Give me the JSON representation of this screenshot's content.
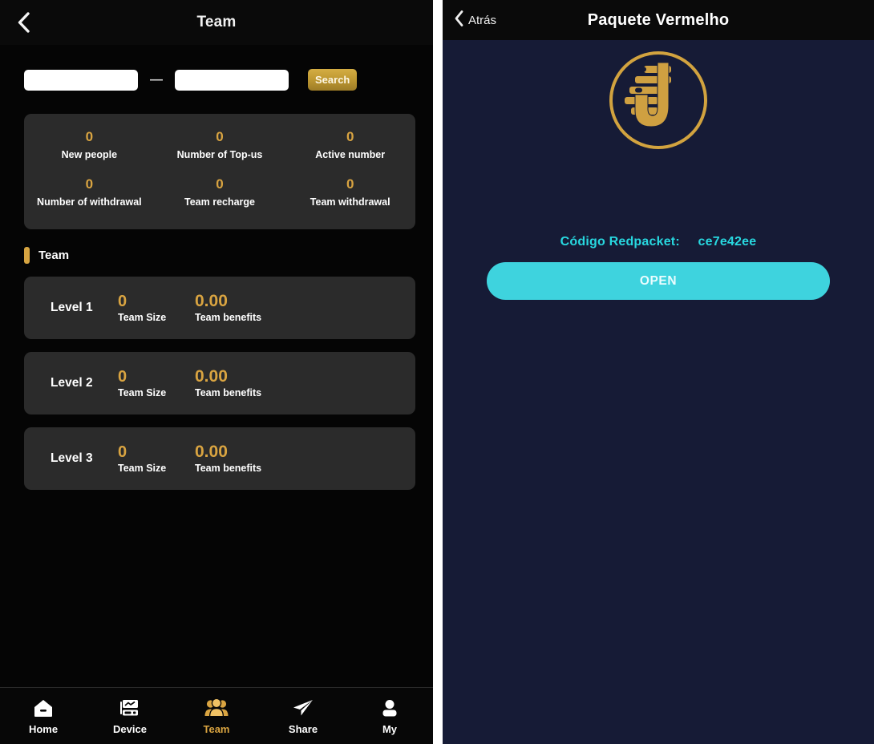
{
  "left": {
    "header": {
      "title": "Team",
      "back_icon": "chevron-left-icon"
    },
    "search": {
      "from_value": "",
      "to_value": "",
      "from_placeholder": "",
      "to_placeholder": "",
      "separator": "—",
      "button_label": "Search"
    },
    "stats": [
      {
        "value": "0",
        "label": "New people"
      },
      {
        "value": "0",
        "label": "Number of Top-us"
      },
      {
        "value": "0",
        "label": "Active number"
      },
      {
        "value": "0",
        "label": "Number of withdrawal"
      },
      {
        "value": "0",
        "label": "Team recharge"
      },
      {
        "value": "0",
        "label": "Team withdrawal"
      }
    ],
    "section": {
      "title": "Team"
    },
    "levels": [
      {
        "name": "Level 1",
        "size": "0",
        "size_label": "Team Size",
        "benefits": "0.00",
        "benefits_label": "Team benefits"
      },
      {
        "name": "Level 2",
        "size": "0",
        "size_label": "Team Size",
        "benefits": "0.00",
        "benefits_label": "Team benefits"
      },
      {
        "name": "Level 3",
        "size": "0",
        "size_label": "Team Size",
        "benefits": "0.00",
        "benefits_label": "Team benefits"
      }
    ],
    "tabs": [
      {
        "label": "Home",
        "icon": "home-icon",
        "active": false
      },
      {
        "label": "Device",
        "icon": "device-icon",
        "active": false
      },
      {
        "label": "Team",
        "icon": "team-people-icon",
        "active": true
      },
      {
        "label": "Share",
        "icon": "paper-plane-icon",
        "active": false
      },
      {
        "label": "My",
        "icon": "user-profile-icon",
        "active": false
      }
    ]
  },
  "right": {
    "header": {
      "back_label": "Atrás",
      "back_icon": "chevron-left-icon",
      "title": "Paquete Vermelho"
    },
    "logo": {
      "name": "brand-u-logo"
    },
    "code": {
      "label": "Código Redpacket:",
      "value": "ce7e42ee"
    },
    "open_button": {
      "label": "OPEN"
    }
  },
  "colors": {
    "gold": "#d9a441",
    "cyan": "#28d8e0",
    "open_button_bg": "#3ed3de",
    "navy_bg": "#161b36",
    "card_bg": "#2b2b2b",
    "black_bg": "#050505"
  }
}
